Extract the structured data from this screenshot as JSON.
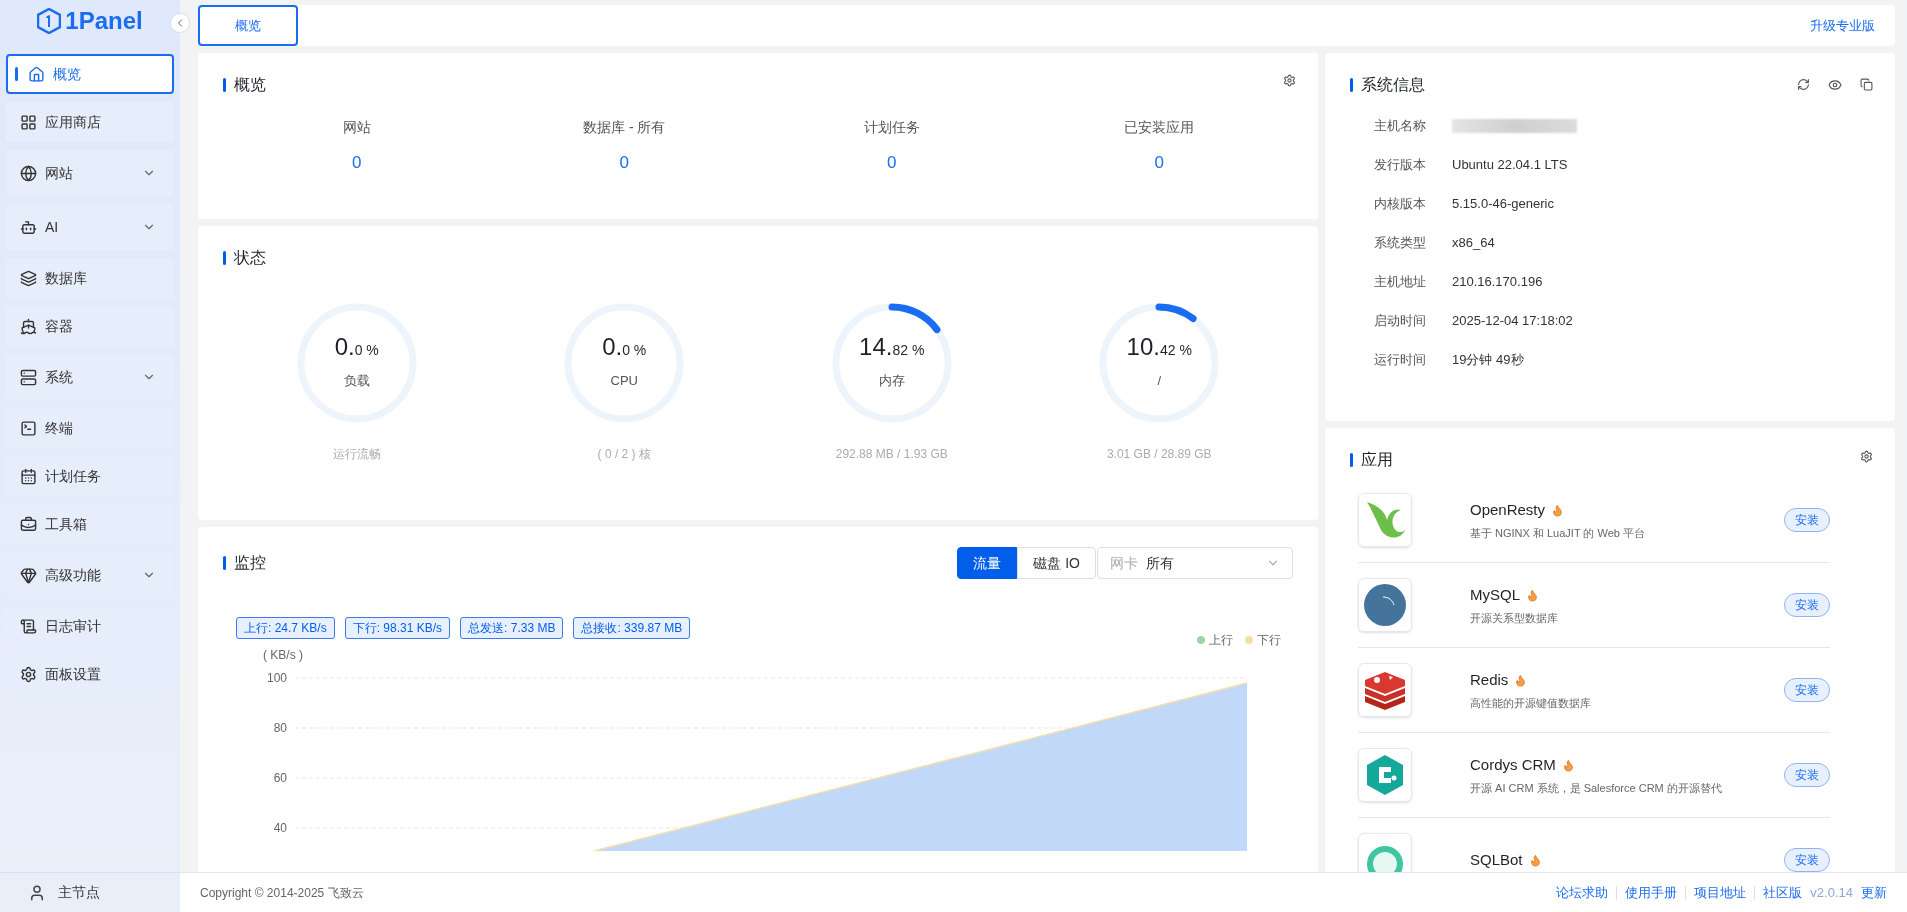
{
  "brand": {
    "name": "1Panel"
  },
  "sidebar": {
    "items": [
      {
        "label": "概览",
        "selected": true,
        "has_submenu": false
      },
      {
        "label": "应用商店",
        "selected": false,
        "has_submenu": false
      },
      {
        "label": "网站",
        "selected": false,
        "has_submenu": true
      },
      {
        "label": "AI",
        "selected": false,
        "has_submenu": true
      },
      {
        "label": "数据库",
        "selected": false,
        "has_submenu": false
      },
      {
        "label": "容器",
        "selected": false,
        "has_submenu": false
      },
      {
        "label": "系统",
        "selected": false,
        "has_submenu": true
      },
      {
        "label": "终端",
        "selected": false,
        "has_submenu": false
      },
      {
        "label": "计划任务",
        "selected": false,
        "has_submenu": false
      },
      {
        "label": "工具箱",
        "selected": false,
        "has_submenu": false
      },
      {
        "label": "高级功能",
        "selected": false,
        "has_submenu": true
      },
      {
        "label": "日志审计",
        "selected": false,
        "has_submenu": false
      },
      {
        "label": "面板设置",
        "selected": false,
        "has_submenu": false
      }
    ],
    "node": "主节点"
  },
  "tabs": [
    {
      "label": "概览",
      "selected": true
    }
  ],
  "upgrade_link": "升级专业版",
  "overview": {
    "title": "概览",
    "stats": [
      {
        "label": "网站",
        "value": "0"
      },
      {
        "label": "数据库 - 所有",
        "value": "0"
      },
      {
        "label": "计划任务",
        "value": "0"
      },
      {
        "label": "已安装应用",
        "value": "0"
      }
    ]
  },
  "status": {
    "title": "状态",
    "gauges": [
      {
        "main": "0.",
        "fraction": "0 %",
        "label": "负载",
        "caption": "运行流畅"
      },
      {
        "main": "0.",
        "fraction": "0 %",
        "label": "CPU",
        "caption": "( 0 / 2 ) 核"
      },
      {
        "main": "14.",
        "fraction": "82 %",
        "label": "内存",
        "caption": "292.88 MB / 1.93 GB"
      },
      {
        "main": "10.",
        "fraction": "42 %",
        "label": "/",
        "caption": "3.01 GB / 28.89 GB"
      }
    ]
  },
  "monitor": {
    "title": "监控",
    "modes": [
      {
        "label": "流量",
        "selected": true
      },
      {
        "label": "磁盘 IO",
        "selected": false
      }
    ],
    "nic": {
      "label": "网卡",
      "value": "所有"
    },
    "tags": [
      "上行: 24.7 KB/s",
      "下行: 98.31 KB/s",
      "总发送: 7.33 MB",
      "总接收: 339.87 MB"
    ],
    "legend": [
      {
        "label": "上行",
        "color": "#9fd4a8"
      },
      {
        "label": "下行",
        "color": "#f5dfa8"
      }
    ],
    "y_axis": {
      "unit": "( KB/s )",
      "ticks": [
        "100",
        "80",
        "60",
        "40"
      ]
    }
  },
  "system_info": {
    "title": "系统信息",
    "rows": [
      {
        "label": "主机名称",
        "redacted": true
      },
      {
        "label": "发行版本",
        "value": "Ubuntu 22.04.1 LTS"
      },
      {
        "label": "内核版本",
        "value": "5.15.0-46-generic"
      },
      {
        "label": "系统类型",
        "value": "x86_64"
      },
      {
        "label": "主机地址",
        "value": "210.16.170.196"
      },
      {
        "label": "启动时间",
        "value": "2025-12-04 17:18:02"
      },
      {
        "label": "运行时间",
        "value": "19分钟 49秒"
      }
    ]
  },
  "apps": {
    "title": "应用",
    "items": [
      {
        "name": "OpenResty",
        "description": "基于 NGINX 和 LuaJIT 的 Web 平台",
        "hot": true,
        "button": "安装"
      },
      {
        "name": "MySQL",
        "description": "开源关系型数据库",
        "hot": true,
        "button": "安装"
      },
      {
        "name": "Redis",
        "description": "高性能的开源键值数据库",
        "hot": true,
        "button": "安装"
      },
      {
        "name": "Cordys CRM",
        "description": "开源 AI CRM 系统，是 Salesforce CRM 的开源替代",
        "hot": true,
        "button": "安装"
      },
      {
        "name": "SQLBot",
        "hot": true,
        "button": "安装"
      }
    ]
  },
  "footer": {
    "copyright": "Copyright © 2014-2025 飞致云",
    "links": [
      "论坛求助",
      "使用手册",
      "项目地址",
      "社区版"
    ],
    "version": "v2.0.14",
    "update": "更新"
  }
}
